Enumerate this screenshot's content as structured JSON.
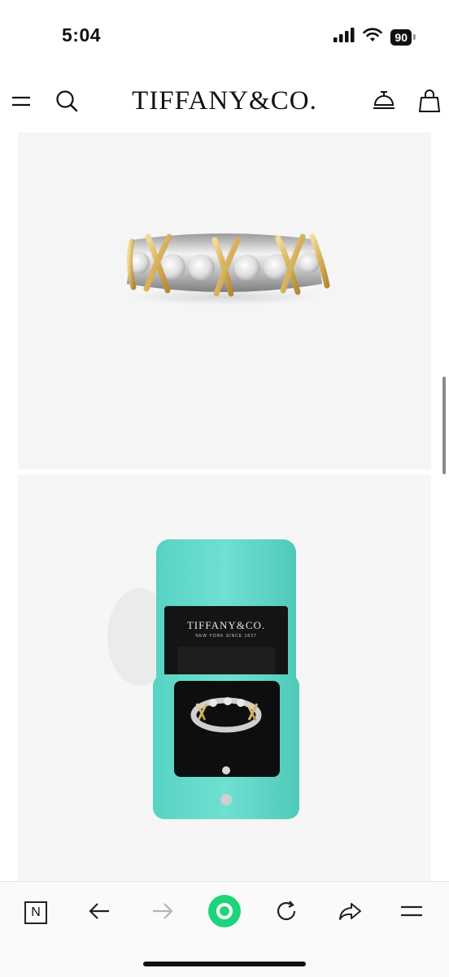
{
  "status_bar": {
    "time": "5:04",
    "battery": "90",
    "icons": [
      "signal-icon",
      "wifi-icon",
      "battery-icon"
    ]
  },
  "header": {
    "logo": "TIFFANY&CO.",
    "left_icons": [
      "menu-icon",
      "search-icon"
    ],
    "right_icons": [
      "concierge-bell-icon",
      "shopping-bag-icon"
    ]
  },
  "images": {
    "photo1": "ring-photo",
    "photo2": "ring-in-box-photo",
    "box_label": "TIFFANY&CO.",
    "box_sub": "NEW YORK SINCE 1837"
  },
  "colors": {
    "tiffany_blue": "#5cd6c6",
    "browser_accent": "#1ed47a"
  },
  "browser_bar": {
    "icons": [
      "tab-switcher-icon",
      "back-icon",
      "forward-icon",
      "home-circle-icon",
      "reload-icon",
      "share-icon",
      "browser-menu-icon"
    ],
    "tab_letter": "N"
  }
}
